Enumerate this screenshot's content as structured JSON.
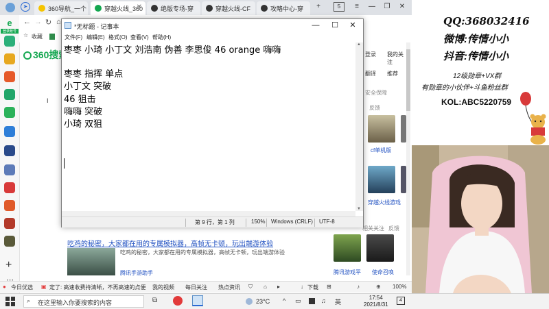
{
  "browser": {
    "tabs": [
      {
        "label": "360导航_一个"
      },
      {
        "label": "穿越火线_360"
      },
      {
        "label": "绝版专场-穿"
      },
      {
        "label": "穿越火线-CF"
      },
      {
        "label": "攻略中心-穿"
      }
    ],
    "new_tab": "+",
    "tab_count": "5",
    "bookmarks_label": "收藏",
    "logo_text": "360搜索",
    "side_login": "登录账号",
    "right_panel": {
      "login": "登录",
      "my_follow": "我的关注",
      "translate": "翻译",
      "recommend": "推荐",
      "safe": "安全保障",
      "feedback": "反馈",
      "feedback2": "反馈",
      "game1": "cf单机版",
      "game2": "穿越火线游戏",
      "game3": "腾讯游戏平",
      "game4": "使命召唤",
      "related": "相关关注"
    },
    "ad": {
      "title": "吃鸡的秘密，大家都在用的专属模拟器，高帧无卡顿，玩出端游体验",
      "desc": "吃鸡的秘密，大家都在用的专属模拟器，高帧无卡顿，玩出端游体验",
      "link": "腾讯手游助手"
    },
    "statusbar": {
      "today": "今日优选",
      "news": "定了: 高速收费持清晰，不再高速的点便宜",
      "video": "我的视频",
      "hot": "每日关注",
      "info": "热点资讯",
      "download": "下载",
      "zoom": "100%"
    }
  },
  "notepad": {
    "title": "*无标题 - 记事本",
    "menu": [
      "文件(F)",
      "编辑(E)",
      "格式(O)",
      "查看(V)",
      "帮助(H)"
    ],
    "lines": [
      "枣枣 小琦 小丁文 刘浩南 伪善 李思俊 46  orange  嗨嗨",
      "",
      "枣枣 指挥 单点",
      "小丁文  突破",
      "46  狙击",
      "嗨嗨 突破",
      "小琦 双狙"
    ],
    "status": {
      "position": "第 9 行，第 1 列",
      "zoom": "150%",
      "eol": "Windows (CRLF)",
      "encoding": "UTF-8"
    }
  },
  "overlay": {
    "qq": "QQ:368032416",
    "weibo": "微博:传情小小",
    "douyin": "抖音:传情小小",
    "badge_line1": "12级勋章+VX群",
    "badge_line2": "有勋章的小伙伴+斗鱼粉丝群",
    "kol": "KOL:ABC5220759"
  },
  "taskbar": {
    "search_placeholder": "在这里输入你要搜索的内容",
    "temperature": "23°C",
    "time": "17:54",
    "date": "2021/8/31",
    "notification_count": "4"
  },
  "colors": {
    "accent_green": "#14a750",
    "link_blue": "#2252c2"
  }
}
